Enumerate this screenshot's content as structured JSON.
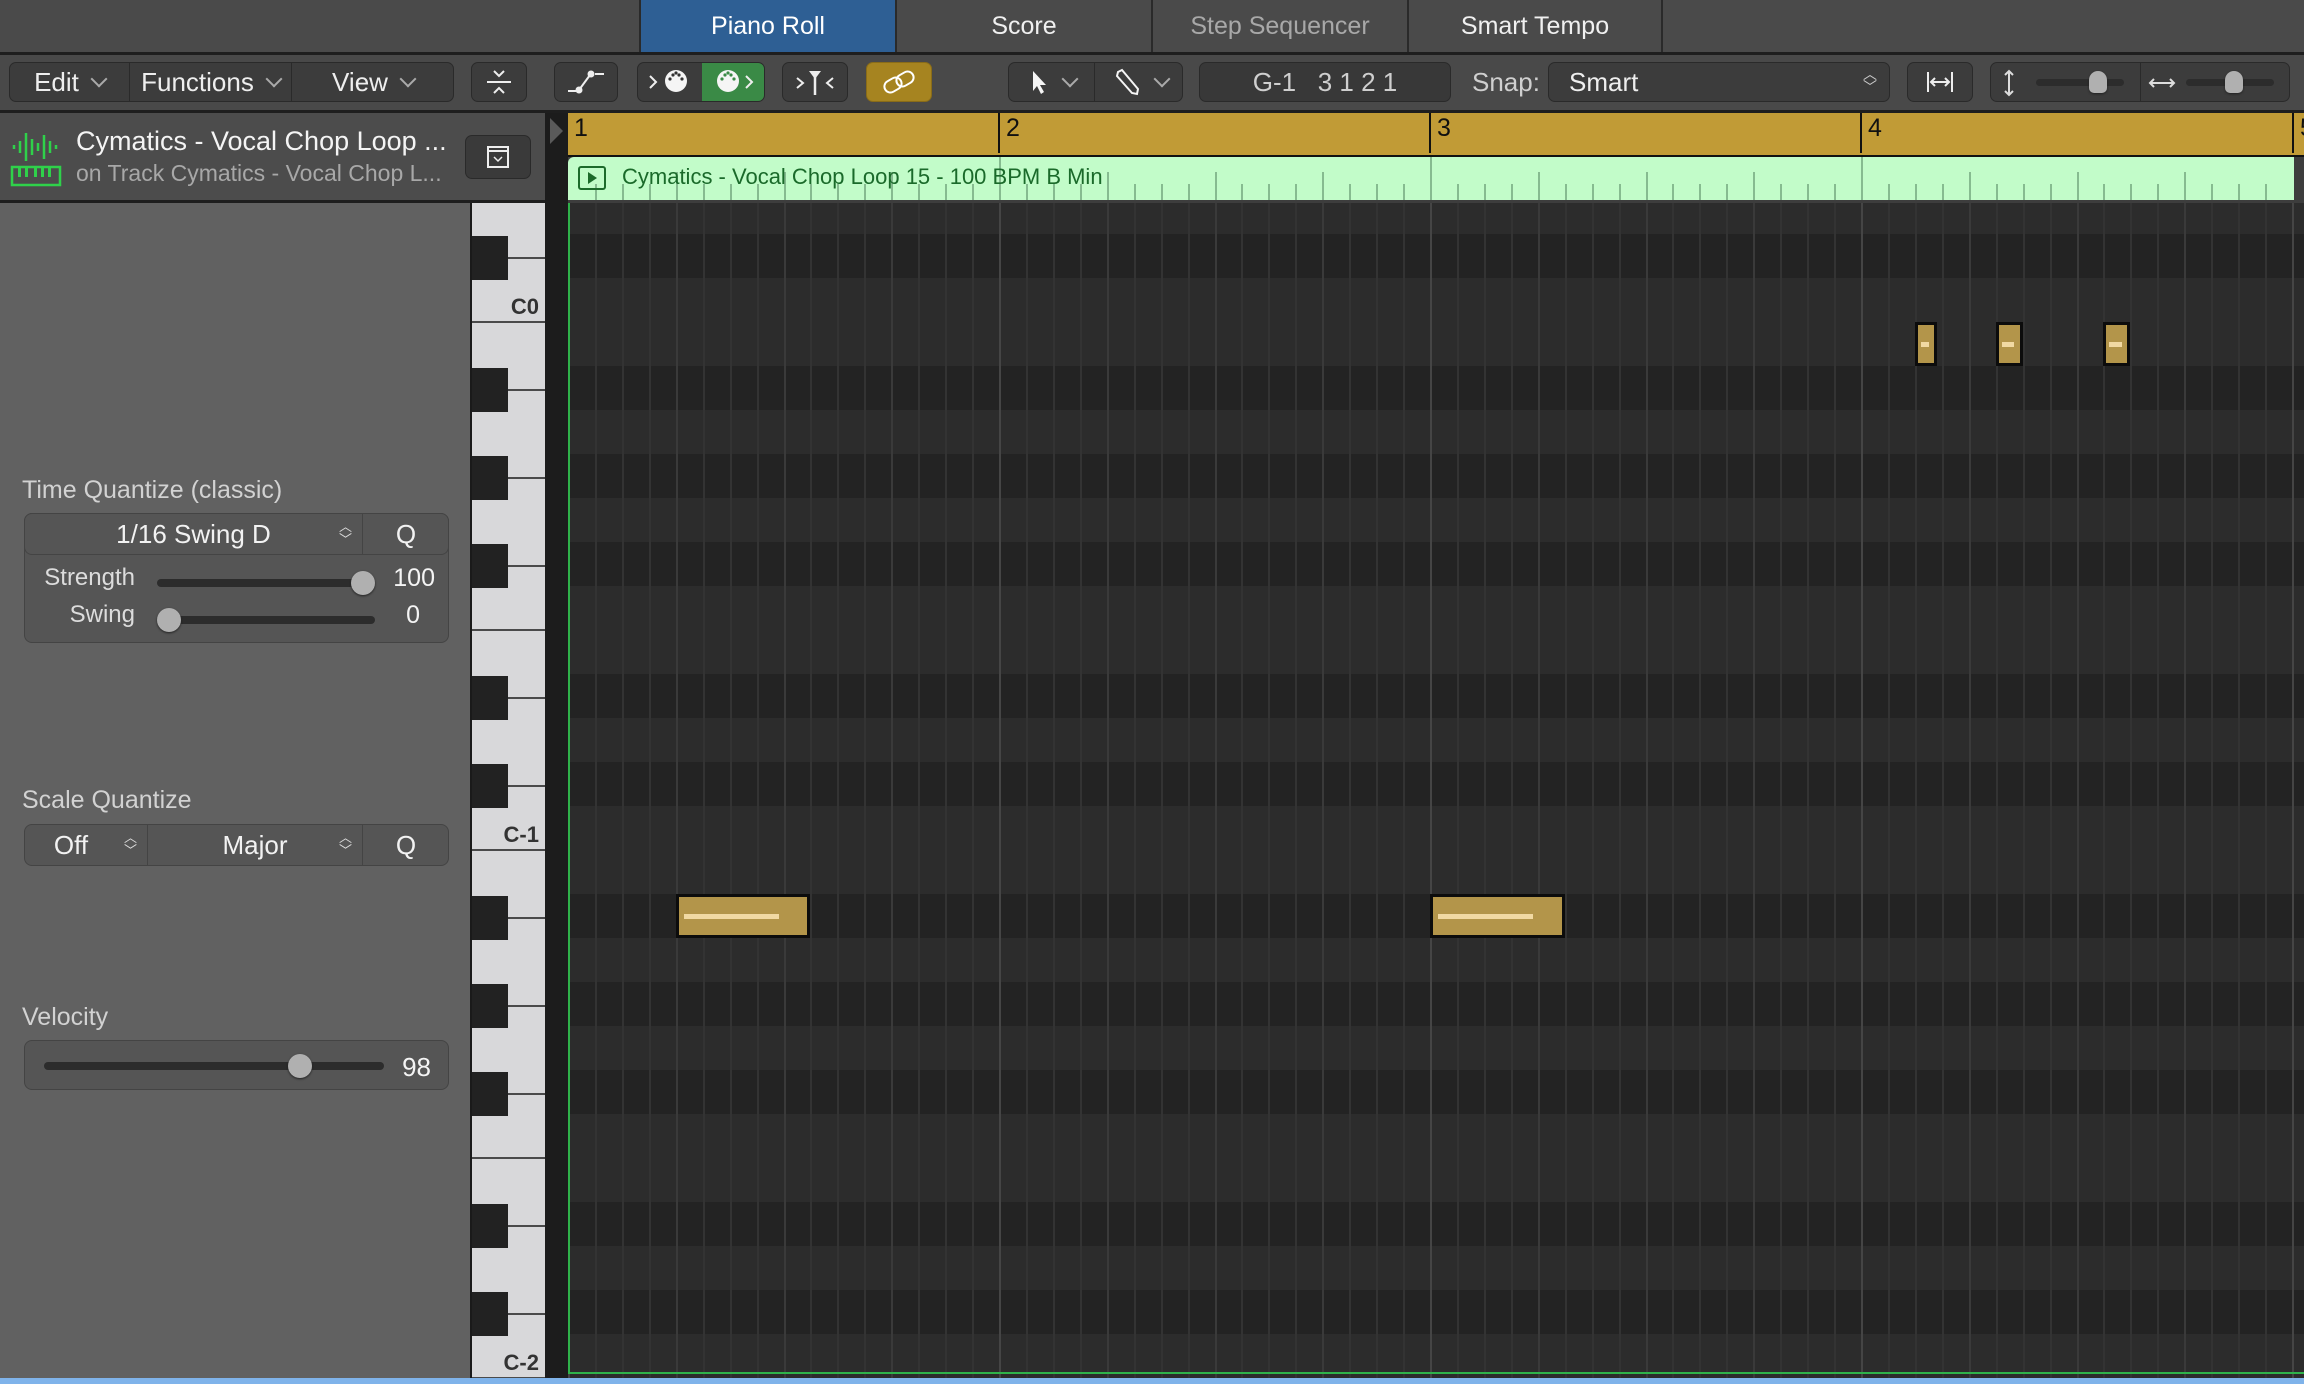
{
  "tabs": [
    {
      "label": "Piano Roll",
      "active": true
    },
    {
      "label": "Score",
      "active": false
    },
    {
      "label": "Step Sequencer",
      "active": false,
      "dimmed": true
    },
    {
      "label": "Smart Tempo",
      "active": false
    }
  ],
  "toolbar": {
    "menus": [
      {
        "label": "Edit"
      },
      {
        "label": "Functions"
      },
      {
        "label": "View"
      }
    ],
    "icons": [
      "collapse-icon",
      "automation-icon",
      "midi-in-icon",
      "midi-out-icon",
      "catch-icon",
      "link-icon",
      "pointer-tool-icon",
      "pencil-tool-icon"
    ],
    "position_display": "G-1   3 1 2 1",
    "snap_label": "Snap:",
    "snap_value": "Smart",
    "vertical_zoom": 0.75,
    "horizontal_zoom": 0.55
  },
  "region_header": {
    "title": "Cymatics - Vocal Chop Loop ...",
    "subtitle": "on Track Cymatics - Vocal Chop L..."
  },
  "time_quantize": {
    "label": "Time Quantize (classic)",
    "value": "1/16 Swing D",
    "q_label": "Q",
    "strength_label": "Strength",
    "strength_value": "100",
    "strength": 100,
    "swing_label": "Swing",
    "swing_value": "0",
    "swing": 0
  },
  "scale_quantize": {
    "label": "Scale Quantize",
    "root_value": "Off",
    "scale_value": "Major",
    "q_label": "Q"
  },
  "velocity": {
    "label": "Velocity",
    "value": "98",
    "level": 98
  },
  "keyboard": {
    "labels": [
      {
        "text": "C0"
      },
      {
        "text": "C-1"
      },
      {
        "text": "C-2"
      }
    ]
  },
  "ruler": {
    "measures": [
      "1",
      "2",
      "3",
      "4",
      "5"
    ]
  },
  "region": {
    "name": "Cymatics - Vocal Chop Loop 15 - 100 BPM B Min"
  },
  "notes": [
    {
      "pitch": "B-1",
      "start": "4 1 3",
      "length_16ths": 0.5,
      "velocity_fraction": 0.3
    },
    {
      "pitch": "B-1",
      "start": "4 2 2",
      "length_16ths": 1,
      "velocity_fraction": 0.6
    },
    {
      "pitch": "B-1",
      "start": "4 3 2",
      "length_16ths": 1,
      "velocity_fraction": 0.6
    },
    {
      "pitch": "A#-2",
      "start": "1 2 1",
      "length_16ths": 5,
      "velocity_fraction": 0.74
    },
    {
      "pitch": "A#-2",
      "start": "3 1 1",
      "length_16ths": 5,
      "velocity_fraction": 0.74
    }
  ],
  "colors": {
    "active_tab": "#2e5f94",
    "ruler": "#c19b36",
    "region": "#c2fcc9",
    "note": "#b3954a",
    "midi_out_active": "#3a8a46",
    "link_active": "#a68420",
    "playhead": "#2fb24a"
  }
}
